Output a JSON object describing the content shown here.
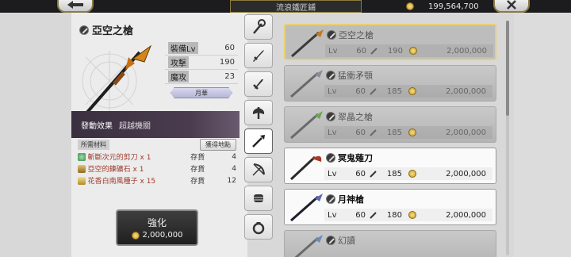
{
  "header": {
    "title": "流浪鐵匠鋪",
    "gold": "199,564,700",
    "back_icon": "back-arrow-icon",
    "close_icon": "close-icon"
  },
  "detail": {
    "name": "亞空之槍",
    "stats": [
      {
        "label": "裝備Lv",
        "value": "60"
      },
      {
        "label": "攻擊",
        "value": "190"
      },
      {
        "label": "魔攻",
        "value": "23"
      }
    ],
    "slot": "月華",
    "effect_label": "發動效果",
    "effect_value": "超越機關",
    "materials_label": "所需材料",
    "acquire_label": "獲得地點",
    "materials": [
      {
        "name": "斬斷次元的剪刀 x 1",
        "stock_label": "存貨",
        "count": "4"
      },
      {
        "name": "亞空的鍊礦石 x 1",
        "stock_label": "存貨",
        "count": "4"
      },
      {
        "name": "花香白南風種子 x 15",
        "stock_label": "存貨",
        "count": "12"
      }
    ],
    "upgrade_label": "強化",
    "upgrade_cost": "2,000,000"
  },
  "tabs": [
    "staff-icon",
    "sword-icon",
    "dagger-icon",
    "axe-icon",
    "spear-icon",
    "bow-icon",
    "fist-icon",
    "ring-icon"
  ],
  "weapons": [
    {
      "name": "亞空之槍",
      "lv_label": "Lv",
      "lv": "60",
      "atk": "190",
      "price": "2,000,000",
      "state": "selected"
    },
    {
      "name": "猛衝矛顎",
      "lv_label": "Lv",
      "lv": "60",
      "atk": "185",
      "price": "2,000,000",
      "state": "locked"
    },
    {
      "name": "翠晶之槍",
      "lv_label": "Lv",
      "lv": "60",
      "atk": "185",
      "price": "2,000,000",
      "state": "locked"
    },
    {
      "name": "冥鬼薙刀",
      "lv_label": "Lv",
      "lv": "60",
      "atk": "185",
      "price": "2,000,000",
      "state": "owned"
    },
    {
      "name": "月神槍",
      "lv_label": "Lv",
      "lv": "60",
      "atk": "180",
      "price": "2,000,000",
      "state": "owned"
    },
    {
      "name": "幻讀",
      "lv_label": "",
      "lv": "",
      "atk": "",
      "price": "",
      "state": "locked"
    }
  ],
  "colors": {
    "accent_gold": "#e8cf72",
    "effect_bar": "#3a3040",
    "material_text": "#a03a2a"
  }
}
